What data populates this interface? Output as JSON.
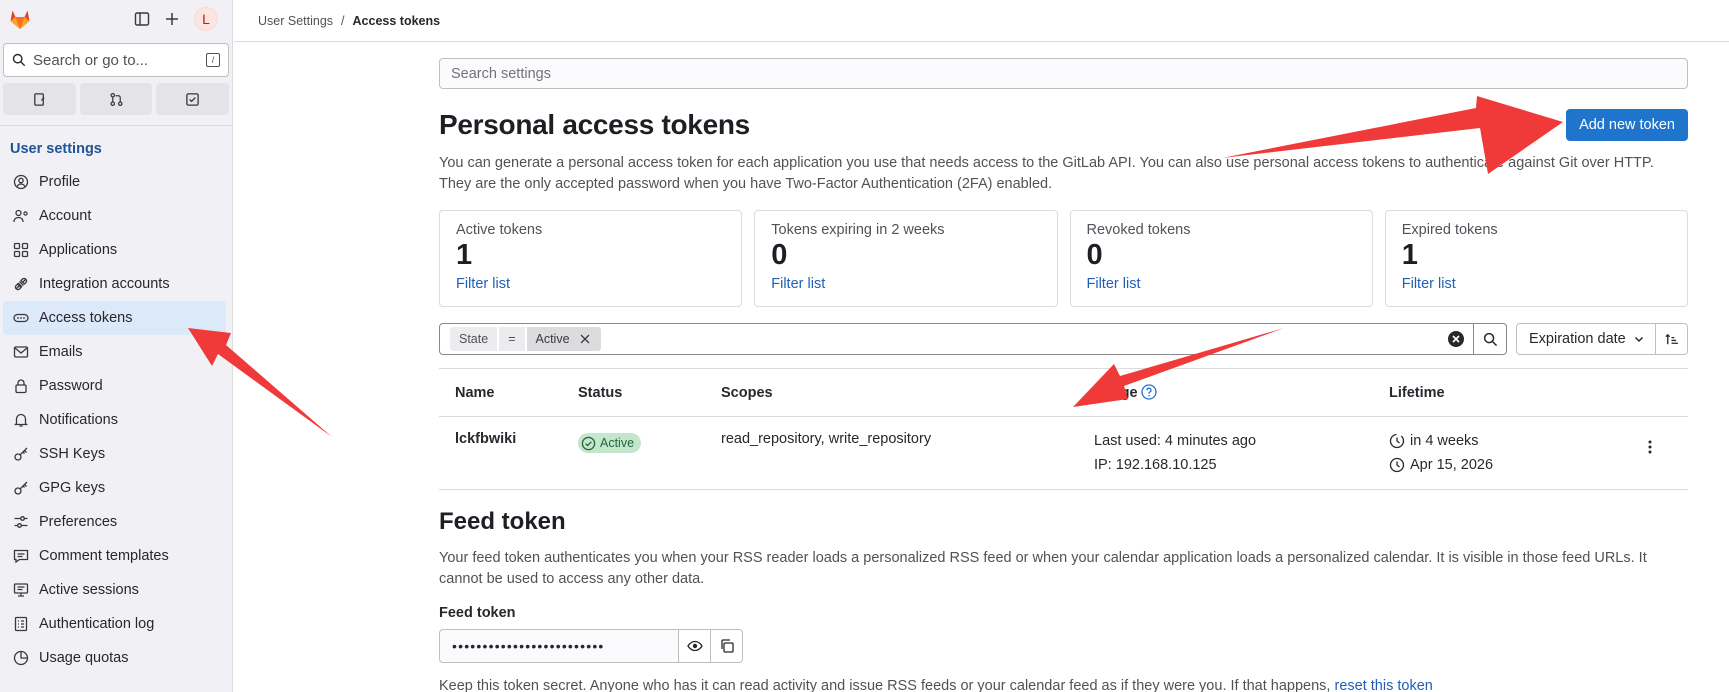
{
  "sidebar": {
    "avatar_letter": "L",
    "search_placeholder": "Search or go to...",
    "search_shortcut": "/",
    "section_title": "User settings",
    "items": [
      {
        "label": "Profile",
        "icon": "profile-icon"
      },
      {
        "label": "Account",
        "icon": "account-icon"
      },
      {
        "label": "Applications",
        "icon": "applications-icon"
      },
      {
        "label": "Integration accounts",
        "icon": "integration-icon"
      },
      {
        "label": "Access tokens",
        "icon": "token-icon",
        "active": true
      },
      {
        "label": "Emails",
        "icon": "mail-icon"
      },
      {
        "label": "Password",
        "icon": "lock-icon"
      },
      {
        "label": "Notifications",
        "icon": "bell-icon"
      },
      {
        "label": "SSH Keys",
        "icon": "key-icon"
      },
      {
        "label": "GPG keys",
        "icon": "key-icon"
      },
      {
        "label": "Preferences",
        "icon": "preferences-icon"
      },
      {
        "label": "Comment templates",
        "icon": "comment-icon"
      },
      {
        "label": "Active sessions",
        "icon": "monitor-icon"
      },
      {
        "label": "Authentication log",
        "icon": "log-icon"
      },
      {
        "label": "Usage quotas",
        "icon": "quota-icon"
      }
    ]
  },
  "breadcrumb": {
    "parent": "User Settings",
    "current": "Access tokens"
  },
  "settings_search": {
    "placeholder": "Search settings"
  },
  "page": {
    "title": "Personal access tokens",
    "add_button": "Add new token",
    "description": "You can generate a personal access token for each application you use that needs access to the GitLab API. You can also use personal access tokens to authenticate against Git over HTTP. They are the only accepted password when you have Two-Factor Authentication (2FA) enabled."
  },
  "stats": [
    {
      "label": "Active tokens",
      "value": "1",
      "link": "Filter list"
    },
    {
      "label": "Tokens expiring in 2 weeks",
      "value": "0",
      "link": "Filter list"
    },
    {
      "label": "Revoked tokens",
      "value": "0",
      "link": "Filter list"
    },
    {
      "label": "Expired tokens",
      "value": "1",
      "link": "Filter list"
    }
  ],
  "filter": {
    "token_key": "State",
    "token_op": "=",
    "token_value": "Active",
    "sort_label": "Expiration date"
  },
  "table": {
    "headers": {
      "name": "Name",
      "status": "Status",
      "scopes": "Scopes",
      "usage": "Usage",
      "lifetime": "Lifetime"
    },
    "rows": [
      {
        "name": "lckfbwiki",
        "status": "Active",
        "scopes": "read_repository, write_repository",
        "last_used": "Last used: 4 minutes ago",
        "ip": "IP: 192.168.10.125",
        "expires_in": "in 4 weeks",
        "expires_on": "Apr 15, 2026"
      }
    ]
  },
  "feed": {
    "title": "Feed token",
    "description": "Your feed token authenticates you when your RSS reader loads a personalized RSS feed or when your calendar application loads a personalized calendar. It is visible in those feed URLs. It cannot be used to access any other data.",
    "label": "Feed token",
    "masked_value": "•••••••••••••••••••••••••",
    "footnote_text": "Keep this token secret. Anyone who has it can read activity and issue RSS feeds or your calendar feed as if they were you. If that happens, ",
    "footnote_link": "reset this token"
  },
  "colors": {
    "accent": "#1f75cb",
    "arrow": "#f03a3a",
    "active_nav": "#dce9f8",
    "success_badge": "#c3e6cd"
  }
}
